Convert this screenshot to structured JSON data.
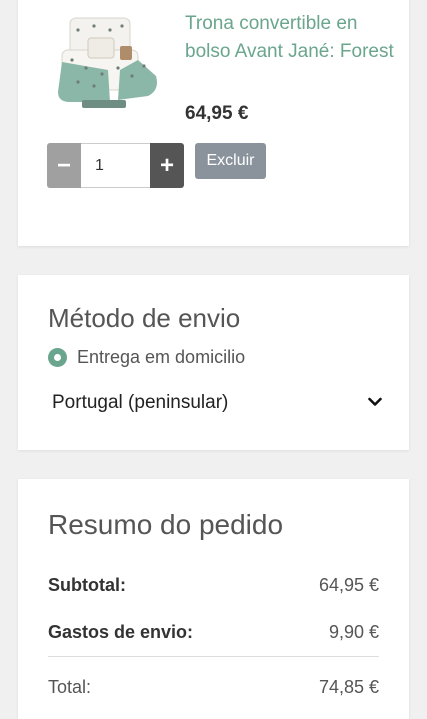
{
  "product": {
    "name": "Trona convertible en bolso Avant Jané: Forest",
    "price": "64,95 €",
    "quantity": "1",
    "minus_label": "−",
    "plus_label": "+",
    "remove_label": "Excluir"
  },
  "shipping": {
    "title": "Método de envio",
    "option_label": "Entrega em domicilio",
    "region": "Portugal (peninsular)"
  },
  "summary": {
    "title": "Resumo do pedido",
    "subtotal_label": "Subtotal:",
    "subtotal_value": "64,95 €",
    "shipping_label": "Gastos de envio:",
    "shipping_value": "9,90 €",
    "total_label": "Total:",
    "total_value": "74,85 €"
  },
  "colors": {
    "accent_green": "#6aa58d",
    "button_gray": "#8a939c"
  }
}
